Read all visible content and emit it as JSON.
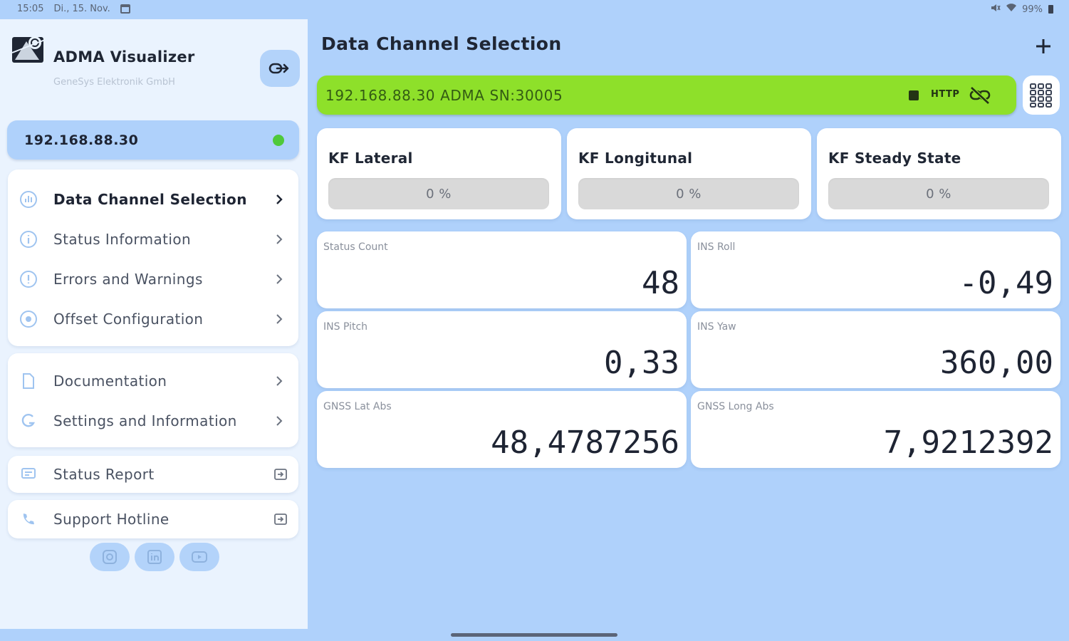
{
  "status_bar": {
    "time": "15:05",
    "date": "Di., 15. Nov.",
    "battery": "99%"
  },
  "sidebar": {
    "app_title": "ADMA Visualizer",
    "app_subtitle": "GeneSys Elektronik GmbH",
    "connection_ip": "192.168.88.30",
    "connection_status_color": "#4fc93a",
    "nav_items": [
      {
        "label": "Data Channel Selection",
        "icon": "data-channel-icon",
        "active": true
      },
      {
        "label": "Status Information",
        "icon": "info-icon"
      },
      {
        "label": "Errors and Warnings",
        "icon": "warning-icon"
      },
      {
        "label": "Offset Configuration",
        "icon": "offset-icon"
      }
    ],
    "secondary_items": [
      {
        "label": "Documentation",
        "icon": "document-icon"
      },
      {
        "label": "Settings and Information",
        "icon": "settings-icon"
      }
    ],
    "status_report_label": "Status Report",
    "support_hotline_label": "Support Hotline",
    "social": [
      "instagram-icon",
      "linkedin-icon",
      "youtube-icon"
    ]
  },
  "main": {
    "title": "Data Channel Selection",
    "connection_bar": {
      "text": "192.168.88.30 ADMA SN:30005",
      "protocol": "HTTP",
      "color": "#8ee02a"
    },
    "kf_cards": [
      {
        "label": "KF Lateral",
        "value": "0 %",
        "progress": 0
      },
      {
        "label": "KF Longitunal",
        "value": "0 %",
        "progress": 0
      },
      {
        "label": "KF Steady State",
        "value": "0 %",
        "progress": 0
      }
    ],
    "values": [
      {
        "label": "Status Count",
        "value": "48"
      },
      {
        "label": "INS Roll",
        "value": "-0,49"
      },
      {
        "label": "INS Pitch",
        "value": "0,33"
      },
      {
        "label": "INS Yaw",
        "value": "360,00"
      },
      {
        "label": "GNSS Lat Abs",
        "value": "48,4787256"
      },
      {
        "label": "GNSS Long Abs",
        "value": "7,9212392"
      }
    ]
  }
}
